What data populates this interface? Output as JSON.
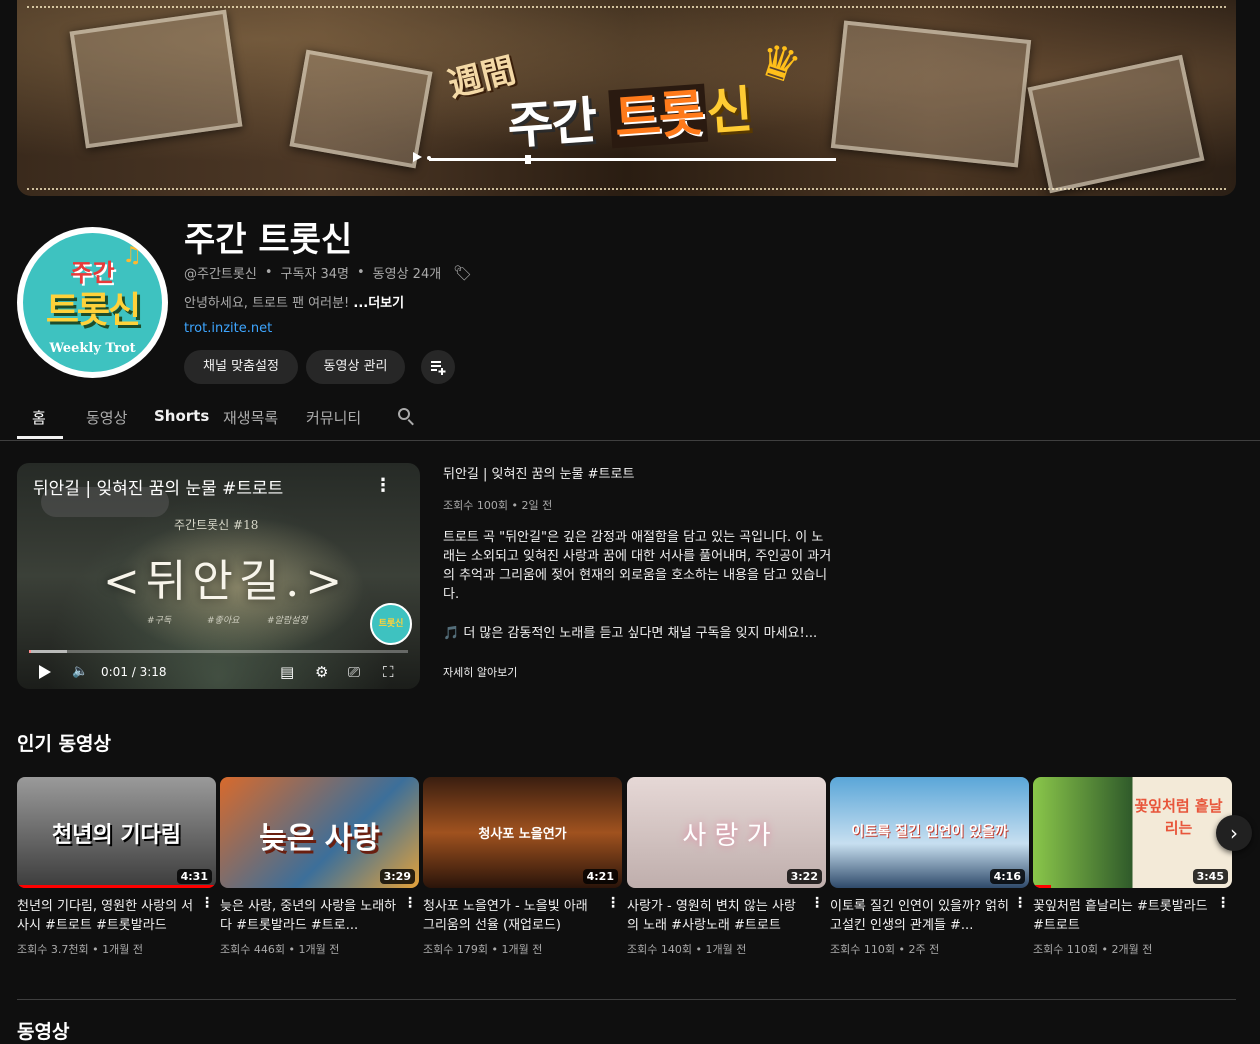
{
  "banner": {
    "hanja": "週間",
    "title_part1": "주간 ",
    "title_part2": "트롯",
    "title_part3": "신"
  },
  "avatar": {
    "line1": "주간",
    "line2": "트롯신",
    "line3": "Weekly Trot"
  },
  "channel": {
    "name": "주간 트롯신",
    "handle": "@주간트롯신",
    "subscribers": "구독자 34명",
    "video_count": "동영상 24개",
    "description": "안녕하세요, 트로트 팬 여러분! ",
    "more_label": "...더보기",
    "link": "trot.inzite.net"
  },
  "buttons": {
    "customize": "채널 맞춤설정",
    "manage": "동영상 관리"
  },
  "tabs": {
    "home": "홈",
    "videos": "동영상",
    "shorts": "Shorts",
    "playlists": "재생목록",
    "community": "커뮤니티"
  },
  "featured": {
    "player_title": "뒤안길 | 잊혀진 꿈의 눈물 #트로트",
    "player_subtitle": "주간트롯신 #18",
    "player_big_text": "<뒤안길.>",
    "player_tags": [
      "#구독",
      "#좋아요",
      "#알람설정"
    ],
    "time": "0:01 / 3:18",
    "progress": 0.005,
    "title": "뒤안길 | 잊혀진 꿈의 눈물 #트로트",
    "views": "조회수 100회",
    "age": "2일 전",
    "description": "트로트 곡 \"뒤안길\"은 깊은 감정과 애절함을 담고 있는 곡입니다. 이 노래는 소외되고 잊혀진 사랑과 꿈에 대한 서사를 풀어내며, 주인공이 과거의 추억과 그리움에 젖어 현재의 외로움을 호소하는 내용을 담고 있습니다.",
    "description2": "🎵 더 많은 감동적인 노래를 듣고 싶다면 채널 구독을 잊지 마세요!...",
    "learn_more": "자세히 알아보기"
  },
  "popular": {
    "heading": "인기 동영상",
    "videos": [
      {
        "thumb_text": "천년의 기다림",
        "duration": "4:31",
        "title": "천년의 기다림, 영원한 사랑의 서사시 #트로트 #트롯발라드",
        "views": "조회수 3.7천회",
        "age": "1개월 전",
        "watched": 1.0
      },
      {
        "thumb_text": "늦은 사랑",
        "duration": "3:29",
        "title": "늦은 사랑, 중년의 사랑을 노래하다 #트롯발라드 #트로...",
        "views": "조회수 446회",
        "age": "1개월 전",
        "watched": 0.0
      },
      {
        "thumb_text": "청사포 노을연가",
        "duration": "4:21",
        "title": "청사포 노을연가 - 노을빛 아래 그리움의 선율 (재업로드)",
        "views": "조회수 179회",
        "age": "1개월 전",
        "watched": 0.0
      },
      {
        "thumb_text": "사 랑 가",
        "duration": "3:22",
        "title": "사랑가 - 영원히 변치 않는 사랑의 노래 #사랑노래 #트로트",
        "views": "조회수 140회",
        "age": "1개월 전",
        "watched": 0.0
      },
      {
        "thumb_text": "이토록 질긴 인연이 있을까",
        "duration": "4:16",
        "title": "이토록 질긴 인연이 있을까? 얽히고설킨 인생의 관계들 #...",
        "views": "조회수 110회",
        "age": "2주 전",
        "watched": 0.0
      },
      {
        "thumb_text": "꽃잎처럼 흩날리는",
        "duration": "3:45",
        "title": "꽃잎처럼 흩날리는 #트롯발라드 #트로트",
        "views": "조회수 110회",
        "age": "2개월 전",
        "watched": 0.09
      }
    ]
  },
  "videos_heading": "동영상"
}
